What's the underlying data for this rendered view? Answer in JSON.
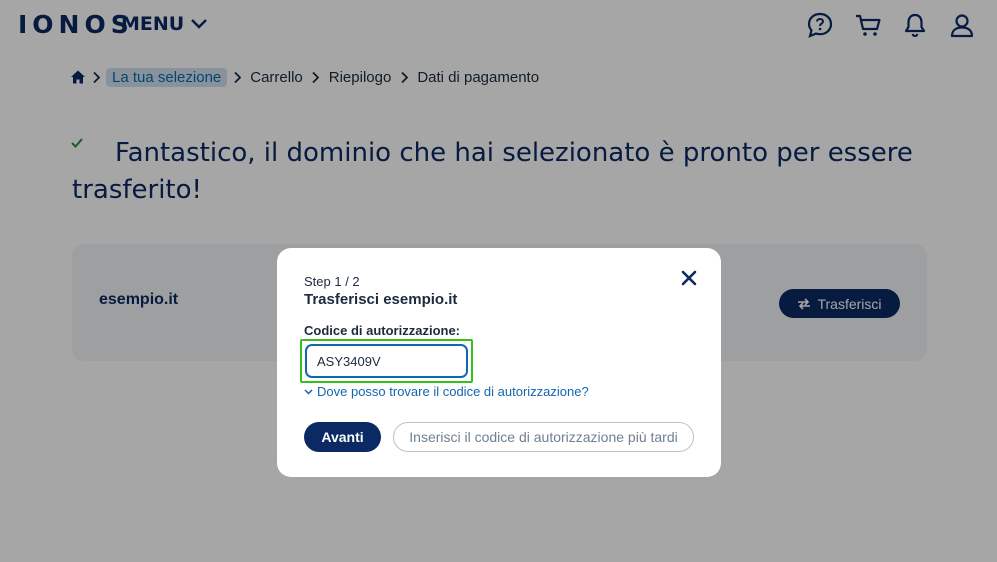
{
  "header": {
    "logo": "IONOS",
    "menu_label": "MENU",
    "icons": [
      "help-chat-icon",
      "cart-icon",
      "bell-icon",
      "user-icon"
    ]
  },
  "breadcrumb": {
    "items": [
      "La tua selezione",
      "Carrello",
      "Riepilogo",
      "Dati di pagamento"
    ]
  },
  "main": {
    "headline": "Fantastico, il dominio che hai selezionato è pronto per essere trasferito!",
    "domain": {
      "name": "esempio.it",
      "transfer_label": "Trasferisci"
    }
  },
  "modal": {
    "step": "Step 1 / 2",
    "title": "Trasferisci esempio.it",
    "field_label": "Codice di autorizzazione:",
    "field_value": "ASY3409V",
    "help_link": "Dove posso trovare il codice di autorizzazione?",
    "primary_label": "Avanti",
    "secondary_label": "Inserisci il codice di autorizzazione più tardi"
  },
  "colors": {
    "brand": "#0b2a63",
    "link": "#1366b0",
    "highlight": "#35c21f",
    "check": "#2e8b3a"
  }
}
